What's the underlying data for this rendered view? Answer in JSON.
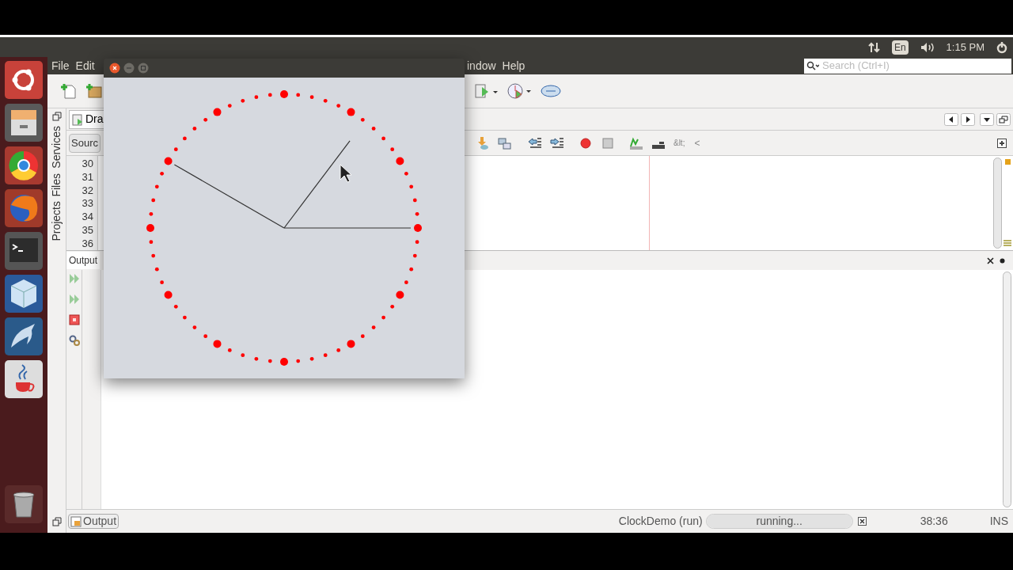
{
  "top_panel": {
    "keyboard": "En",
    "time": "1:15 PM"
  },
  "menu_left": [
    "File",
    "Edit"
  ],
  "menu_right": [
    "indow",
    "Help"
  ],
  "search": {
    "placeholder": "Search (Ctrl+I)"
  },
  "side_tabs": [
    "Services",
    "Files",
    "Projects"
  ],
  "editor_tab": "Dra",
  "source_button": "Sourc",
  "line_numbers": [
    "30",
    "31",
    "32",
    "33",
    "34",
    "35",
    "36"
  ],
  "editor_toolbar_texts": [
    "&lt;",
    "<"
  ],
  "output_tab": "Output",
  "status_bar": {
    "output_button": "Output",
    "task": "ClockDemo (run)",
    "progress": {
      "text": "running...",
      "level": 1
    },
    "position": "38:36",
    "mode": "INS"
  }
}
